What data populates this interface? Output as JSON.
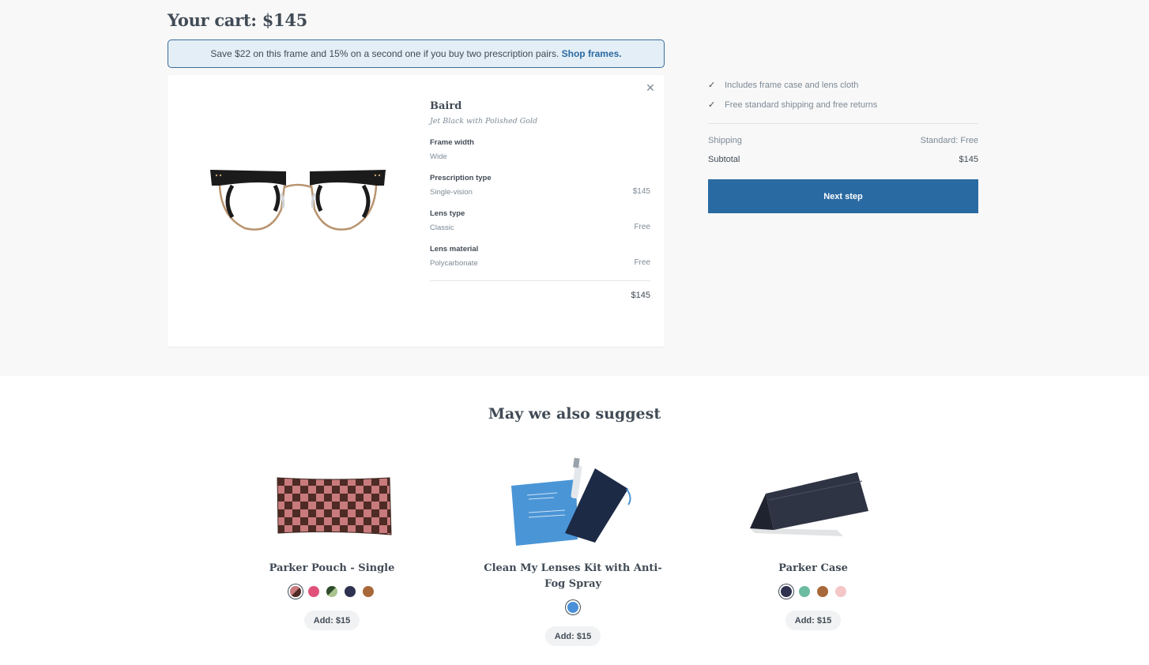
{
  "cart": {
    "title": "Your cart: $145"
  },
  "promo": {
    "text": "Save $22 on this frame and 15% on a second one if you buy two prescription pairs. ",
    "link": "Shop frames."
  },
  "item": {
    "close_icon": "close-icon",
    "name": "Baird",
    "color": "Jet Black with Polished Gold",
    "attributes": [
      {
        "label": "Frame width",
        "value": "Wide",
        "price": ""
      },
      {
        "label": "Prescription type",
        "value": "Single-vision",
        "price": "$145"
      },
      {
        "label": "Lens type",
        "value": "Classic",
        "price": "Free"
      },
      {
        "label": "Lens material",
        "value": "Polycarbonate",
        "price": "Free"
      }
    ],
    "total": "$145"
  },
  "summary": {
    "perks": [
      "Includes frame case and lens cloth",
      "Free standard shipping and free returns"
    ],
    "check_icon": "✓",
    "shipping_label": "Shipping",
    "shipping_value": "Standard: Free",
    "subtotal_label": "Subtotal",
    "subtotal_value": "$145",
    "next_button": "Next step"
  },
  "suggest": {
    "title": "May we also suggest",
    "products": [
      {
        "name": "Parker Pouch - Single",
        "swatches": [
          "#7a4a3a",
          "#e0517a",
          "#3f6a3a",
          "#2e3150",
          "#a8683a"
        ],
        "selected": 0,
        "button": "Add: $15"
      },
      {
        "name": "Clean My Lenses Kit with Anti-Fog Spray",
        "swatches": [
          "#4a90d9"
        ],
        "selected": 0,
        "button": "Add: $15"
      },
      {
        "name": "Parker Case",
        "swatches": [
          "#2e3150",
          "#6dbba0",
          "#a8683a",
          "#f4c6c8"
        ],
        "selected": 0,
        "button": "Add: $15"
      }
    ]
  }
}
